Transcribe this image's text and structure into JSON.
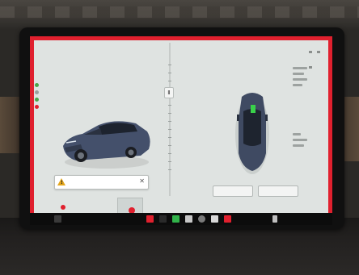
{
  "colors": {
    "screen_background": "#dfe3e1",
    "frame_red": "#e0202e",
    "car_body": "#44506b",
    "warning_amber": "#e4a61b",
    "taskbar": "#0c0c0c"
  },
  "screen": {
    "status_text": ""
  },
  "middle": {
    "button_label": "Ⅱ"
  },
  "left_panel": {
    "label_upper": "",
    "label_top_mid": "",
    "alert": {
      "message": "",
      "close_label": "✕",
      "icon": "warning-triangle-icon"
    },
    "bottom_tag": "",
    "notification_count": ""
  },
  "right_panel": {
    "info_top_left": "",
    "info_top_right": "",
    "pill_left": "",
    "pill_right": ""
  },
  "taskbar": {
    "icons": [
      "car-icon",
      "music-icon",
      "phone-icon",
      "energy-icon",
      "camera-icon",
      "calendar-icon",
      "app-launcher-icon",
      "fan-icon",
      "volume-icon"
    ],
    "temperature": ""
  }
}
